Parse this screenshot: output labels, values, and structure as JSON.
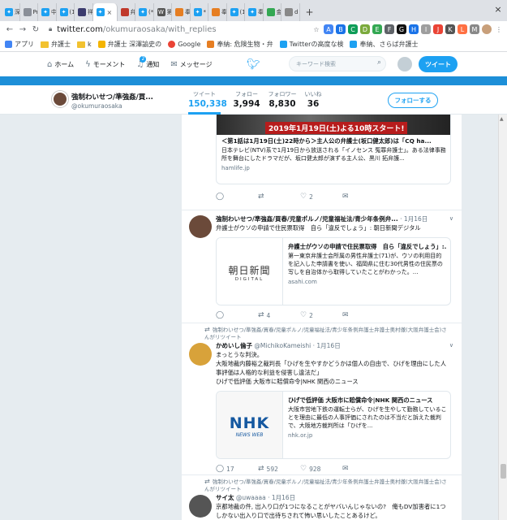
{
  "browser": {
    "tabs": [
      {
        "label": "深",
        "icon": "twitter-icon",
        "color": "#1da1f2"
      },
      {
        "label": "Pr",
        "icon": "page-icon",
        "color": "#8a8f98"
      },
      {
        "label": "中",
        "icon": "twitter-icon",
        "color": "#1da1f2"
      },
      {
        "label": "(1",
        "icon": "twitter-icon",
        "color": "#1da1f2"
      },
      {
        "label": "祥",
        "icon": "page-icon",
        "color": "#3b3b6d"
      },
      {
        "label": "×",
        "icon": "twitter-icon",
        "color": "#1da1f2",
        "active": true
      },
      {
        "label": "弁",
        "icon": "page-icon",
        "color": "#c0392b"
      },
      {
        "label": "(*",
        "icon": "twitter-icon",
        "color": "#1da1f2"
      },
      {
        "label": "第",
        "icon": "wikipedia-icon",
        "color": "#555555"
      },
      {
        "label": "奉",
        "icon": "page-icon",
        "color": "#e67e22"
      },
      {
        "label": "*",
        "icon": "twitter-icon",
        "color": "#1da1f2"
      },
      {
        "label": "奉",
        "icon": "page-icon",
        "color": "#e67e22"
      },
      {
        "label": "(1",
        "icon": "twitter-icon",
        "color": "#1da1f2"
      },
      {
        "label": "奉",
        "icon": "twitter-icon",
        "color": "#1da1f2"
      },
      {
        "label": "金",
        "icon": "page-icon",
        "color": "#34a853"
      },
      {
        "label": "d",
        "icon": "page-icon",
        "color": "#888888"
      }
    ],
    "new_tab": "+",
    "close": "×",
    "url_host": "twitter.com",
    "url_path": "/okumuraosaka/with_replies",
    "bookmarks": [
      {
        "label": "アプリ",
        "kind": "apps"
      },
      {
        "label": "弁護士",
        "kind": "folder"
      },
      {
        "label": "k",
        "kind": "folder"
      },
      {
        "label": "弁護士 深澤諭史の",
        "kind": "page"
      },
      {
        "label": "Google",
        "kind": "google"
      },
      {
        "label": "奉納: 危険生物・弁",
        "kind": "page"
      },
      {
        "label": "Twitterの高度な検",
        "kind": "twitter"
      },
      {
        "label": "奉納、さらば弁護士",
        "kind": "twitter"
      }
    ]
  },
  "twitter_nav": {
    "home": "ホーム",
    "moments": "モーメント",
    "notifications": "通知",
    "notification_count": "2",
    "messages": "メッセージ",
    "search_placeholder": "キーワード検索",
    "tweet_button": "ツイート"
  },
  "profile": {
    "name": "強制わいせつ/準強姦/買...",
    "handle": "@okumuraosaka",
    "stats": [
      {
        "label": "ツイート",
        "value": "150,338"
      },
      {
        "label": "フォロー",
        "value": "3,994"
      },
      {
        "label": "フォロワー",
        "value": "8,830"
      },
      {
        "label": "いいね",
        "value": "36"
      }
    ],
    "follow_button": "フォローする"
  },
  "tweets": [
    {
      "card_banner": "2019年1月19日(土)よる10時スタート!",
      "card_title": "＜第1話は1月19日(土)22時から＞主人公の弁護士(坂口健太郎)は「CQ ha...",
      "card_desc": "日本テレビ(NTV)系で1月19日から放送される「イノセンス 冤罪弁護士」。ある法律事務所を舞台にしたドラマだが、坂口健太郎が演ずる主人公、黒川 拓弁護...",
      "card_domain": "hamlife.jp",
      "replies": "",
      "retweets": "",
      "likes": "2"
    },
    {
      "name": "強制わいせつ/準強姦/買春/児童ポルノ/児童福祉法/青少年条例弁...",
      "time": "1月16日",
      "text": "弁護士がウソの申請で住民票取得　自ら「違反でしょう」: 朝日新聞デジタル",
      "card_logo": "朝日新聞",
      "card_logo_sub": "DIGITAL",
      "card_title": "弁護士がウソの申請で住民票取得　自ら「違反でしょう」:...",
      "card_desc": "第一東京弁護士会所属の男性弁護士(71)が、ウソの利用目的を記入した申請書を使い、福岡県に住む30代男性の住民票の写しを自治体から取得していたことがわかった。...",
      "card_domain": "asahi.com",
      "replies": "",
      "retweets": "4",
      "likes": "2"
    },
    {
      "retweet_note": "強制わいせつ/準強姦/買春/児童ポルノ/児童福祉法/青少年条例弁護士弁護士奥村徹(大阪弁護士会)さんがリツイート",
      "name": "かめいし倫子",
      "handle": "@MichikoKameishi",
      "time": "1月16日",
      "text": "まっとうな判決。\n大阪地裁内藤裕之裁判長「ひげを生やすかどうかは個人の自由で、ひげを理由にした人事評価は人格的な利益を侵害し違法だ」\nひげで低評価 大阪市に賠償命令|NHK 関西のニュース",
      "card_logo": "NHK",
      "card_logo_sub": "NEWS WEB",
      "card_title": "ひげで低評価 大阪市に賠償命令|NHK 関西のニュース",
      "card_desc": "大阪市営地下鉄の運転士らが、ひげを生やして勤務していることを理由に最低の人事評価にされたのは不当だと訴えた裁判で、大阪地方裁判所は「ひげを...",
      "card_domain": "nhk.or.jp",
      "replies": "17",
      "retweets": "592",
      "likes": "928"
    },
    {
      "retweet_note": "強制わいせつ/準強姦/買春/児童ポルノ/児童福祉法/青少年条例弁護士弁護士奥村徹(大阪弁護士会)さんがリツイート",
      "name": "サイ太",
      "handle": "@uwaaaa",
      "time": "1月16日",
      "text": "京都地裁の件, 出入り口が1つになることがヤバいんじゃないの?　俺もDV加害者に1つしかない出入り口で出待ちされて怖い思いしたことあるけど。"
    }
  ]
}
